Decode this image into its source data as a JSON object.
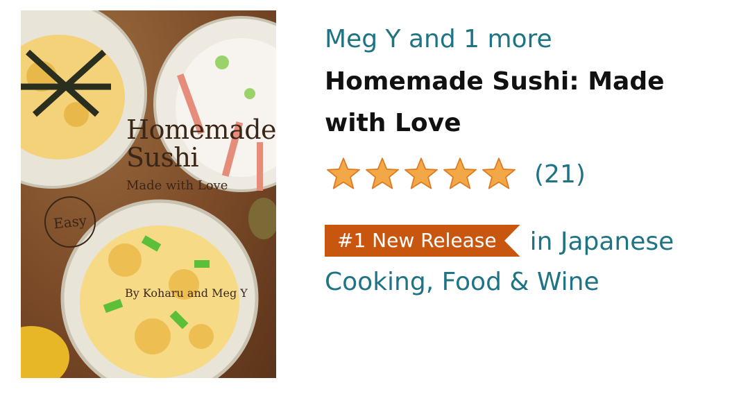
{
  "book": {
    "cover": {
      "title_line1": "Homemade",
      "title_line2": "Sushi",
      "subtitle": "Made with Love",
      "badge": "Easy",
      "author_line": "By Koharu and Meg Y"
    },
    "authors": "Meg Y and 1 more",
    "title": "Homemade Sushi: Made with Love",
    "rating": {
      "stars": 5,
      "max": 5,
      "count": "(21)"
    },
    "rank": {
      "badge": "#1 New Release",
      "category": "in Japanese Cooking, Food & Wine"
    }
  },
  "colors": {
    "link": "#1f7484",
    "star": "#f3a847",
    "badge": "#c8560f"
  },
  "icons": [
    "star-icon"
  ]
}
